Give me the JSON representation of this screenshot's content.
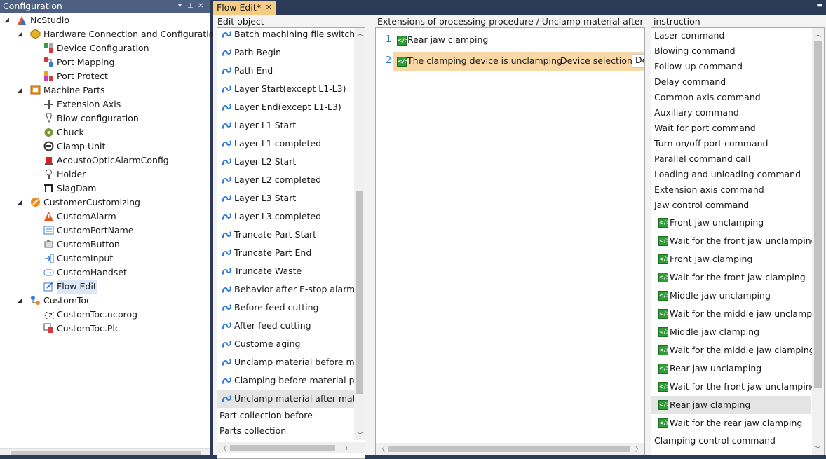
{
  "left_panel": {
    "title": "Configuration",
    "title_buttons": [
      "▾",
      "⊥",
      "✕"
    ],
    "tree": [
      {
        "label": "NcStudio",
        "icon": "ncstudio-icon",
        "level": 0,
        "expander": "◢"
      },
      {
        "label": "Hardware Connection and Configuration",
        "icon": "hardware-icon",
        "level": 1,
        "expander": "◢"
      },
      {
        "label": "Device Configuration",
        "icon": "device-config-icon",
        "level": 2
      },
      {
        "label": "Port Mapping",
        "icon": "port-mapping-icon",
        "level": 2
      },
      {
        "label": "Port Protect",
        "icon": "port-protect-icon",
        "level": 2
      },
      {
        "label": "Machine Parts",
        "icon": "machine-parts-icon",
        "level": 1,
        "expander": "◢"
      },
      {
        "label": "Extension Axis",
        "icon": "extension-axis-icon",
        "level": 2
      },
      {
        "label": "Blow configuration",
        "icon": "blow-icon",
        "level": 2
      },
      {
        "label": "Chuck",
        "icon": "chuck-icon",
        "level": 2
      },
      {
        "label": "Clamp Unit",
        "icon": "clamp-unit-icon",
        "level": 2
      },
      {
        "label": "AcoustoOpticAlarmConfig",
        "icon": "alarm-light-icon",
        "level": 2
      },
      {
        "label": "Holder",
        "icon": "holder-icon",
        "level": 2
      },
      {
        "label": "SlagDam",
        "icon": "slagdam-icon",
        "level": 2
      },
      {
        "label": "CustomerCustomizing",
        "icon": "customizing-icon",
        "level": 1,
        "expander": "◢"
      },
      {
        "label": "CustomAlarm",
        "icon": "warning-icon",
        "level": 2
      },
      {
        "label": "CustomPortName",
        "icon": "port-name-icon",
        "level": 2
      },
      {
        "label": "CustomButton",
        "icon": "button-icon",
        "level": 2
      },
      {
        "label": "CustomInput",
        "icon": "input-icon",
        "level": 2
      },
      {
        "label": "CustomHandset",
        "icon": "gamepad-icon",
        "level": 2
      },
      {
        "label": "Flow Edit",
        "icon": "edit-icon",
        "level": 2,
        "selected": true
      },
      {
        "label": "CustomToc",
        "icon": "toc-icon",
        "level": 1,
        "expander": "◢"
      },
      {
        "label": "CustomToc.ncprog",
        "icon": "code-file-icon",
        "level": 2
      },
      {
        "label": "CustomToc.Plc",
        "icon": "plc-file-icon",
        "level": 2
      }
    ]
  },
  "tab": {
    "label": "Flow Edit*",
    "close": "✕",
    "menu": "▬"
  },
  "edit_object": {
    "header": "Edit object",
    "path_items": [
      "Batch machining file switching",
      "Path Begin",
      "Path End",
      "Layer Start(except L1-L3)",
      "Layer End(except L1-L3)",
      "Layer L1 Start",
      "Layer L1 completed",
      "Layer L2 Start",
      "Layer L2 completed",
      "Layer L3 Start",
      "Layer L3 completed",
      "Truncate Part Start",
      "Truncate Part End",
      "Truncate Waste",
      "Behavior after E-stop alarm",
      "Before feed cutting",
      "After feed cutting",
      "Custome aging",
      "Unclamp material before machining",
      "Clamping before material placing",
      "Unclamp material after material"
    ],
    "selected_index": 20,
    "plain_items": [
      "Part collection before",
      "Parts collection"
    ]
  },
  "procedure": {
    "header": "Extensions of processing procedure / Unclamp material after material",
    "lines": [
      {
        "num": "1",
        "text": "Rear jaw clamping"
      },
      {
        "num": "2",
        "text": "The clamping device is unclamping",
        "extra_label": "Device selection:",
        "extra_value": "De",
        "highlighted": true
      }
    ]
  },
  "instruction": {
    "header": "instruction",
    "groups_before": [
      "Laser command",
      "Blowing command",
      "Follow-up command",
      "Delay command",
      "Common axis command",
      "Auxiliary command",
      "Wait for port command",
      "Turn on/off port command",
      "Parallel command call",
      "Loading and unloading command",
      "Extension axis command",
      "Jaw control command"
    ],
    "jaw_items": [
      "Front jaw unclamping",
      "Wait for the front jaw unclamping",
      "Front jaw clamping",
      "Wait for the front jaw clamping",
      "Middle jaw unclamping",
      "Wait for the middle jaw unclamping",
      "Middle jaw clamping",
      "Wait for the middle jaw clamping",
      "Rear jaw unclamping",
      "Wait for the front jaw unclamping",
      "Rear jaw clamping",
      "Wait for the rear jaw clamping"
    ],
    "selected_jaw_index": 10,
    "groups_after": [
      "Clamping control command"
    ]
  },
  "colors": {
    "title_bar": "#4d6082",
    "tab_active": "#f5cc84",
    "highlight_line": "#f8d8a6",
    "command_icon": "#2e9d35",
    "background": "#2b3b58"
  }
}
